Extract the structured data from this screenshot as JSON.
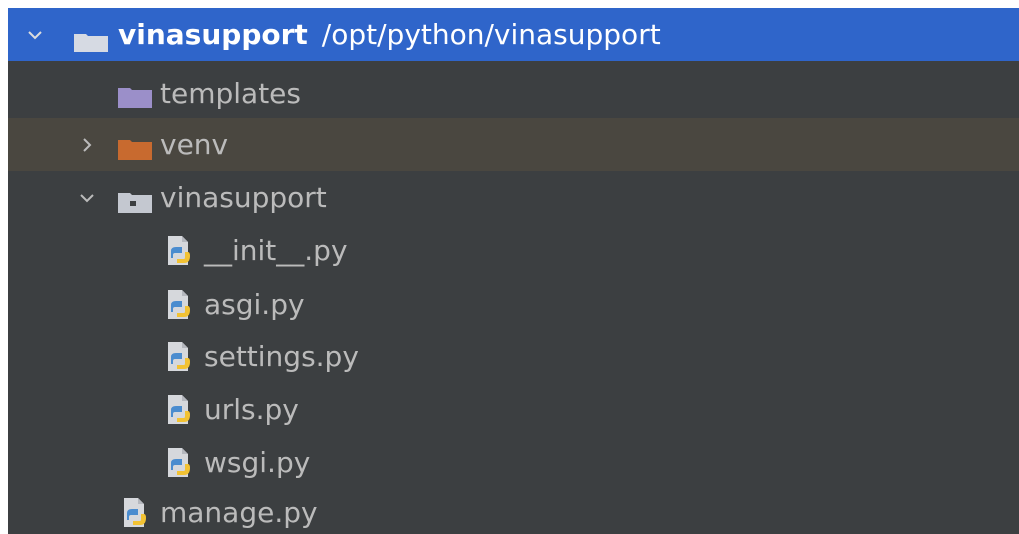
{
  "project": {
    "name": "vinasupport",
    "path": "/opt/python/vinasupport"
  },
  "tree": {
    "items": [
      {
        "label": "templates",
        "icon": "folder-icon"
      },
      {
        "label": "venv",
        "icon": "excluded-folder-icon"
      },
      {
        "label": "vinasupport",
        "icon": "package-icon"
      },
      {
        "label": "__init__.py",
        "icon": "python-file-icon"
      },
      {
        "label": "asgi.py",
        "icon": "python-file-icon"
      },
      {
        "label": "settings.py",
        "icon": "python-file-icon"
      },
      {
        "label": "urls.py",
        "icon": "python-file-icon"
      },
      {
        "label": "wsgi.py",
        "icon": "python-file-icon"
      },
      {
        "label": "manage.py",
        "icon": "python-file-icon"
      }
    ]
  },
  "colors": {
    "selection": "#2f65ca",
    "panel_background": "#3c3f41",
    "excluded_row": "#4a4740",
    "folder": "#9b8fc9",
    "excluded_folder": "#c86a2f",
    "text": "#bbbbbb"
  }
}
